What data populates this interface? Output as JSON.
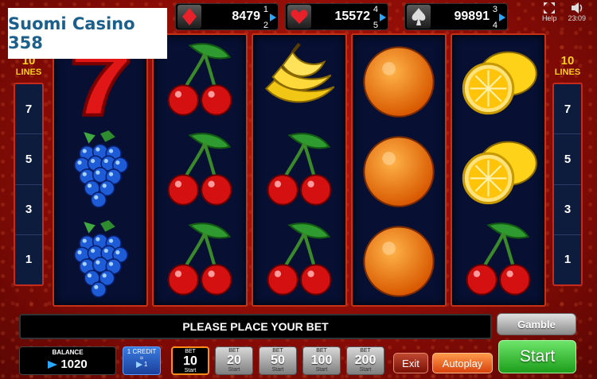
{
  "brand": {
    "logo_text": "Suomi Casino 358"
  },
  "jackpots": [
    {
      "suit": "diamond",
      "value": "8479",
      "level_top": "1",
      "level_bottom": "2",
      "suit_color": "#e8202a"
    },
    {
      "suit": "heart",
      "value": "15572",
      "level_top": "4",
      "level_bottom": "5",
      "suit_color": "#e8202a"
    },
    {
      "suit": "spade",
      "value": "99891",
      "level_top": "3",
      "level_bottom": "4",
      "suit_color": "#dddddd"
    }
  ],
  "tools": {
    "help_label": "Help",
    "clock": "23:09"
  },
  "lines": {
    "left_label_num": "10",
    "left_label_text": "LINES",
    "right_label_num": "10",
    "right_label_text": "LINES",
    "values": [
      "7",
      "5",
      "3",
      "1"
    ]
  },
  "reels": [
    [
      "seven",
      "grapes",
      "grapes"
    ],
    [
      "cherry",
      "cherry",
      "cherry"
    ],
    [
      "banana",
      "cherry",
      "cherry"
    ],
    [
      "orange",
      "orange",
      "orange"
    ],
    [
      "lemon",
      "lemon",
      "cherry"
    ]
  ],
  "message": "PLEASE PLACE YOUR BET",
  "gamble_label": "Gamble",
  "balance": {
    "label": "BALANCE",
    "value": "1020"
  },
  "credit": {
    "line1": "1 CREDIT",
    "line2": "=",
    "line3": "1"
  },
  "bets": [
    {
      "label": "BET",
      "value": "10",
      "sub": "Start",
      "active": true
    },
    {
      "label": "BET",
      "value": "20",
      "sub": "Start",
      "active": false
    },
    {
      "label": "BET",
      "value": "50",
      "sub": "Start",
      "active": false
    },
    {
      "label": "BET",
      "value": "100",
      "sub": "Start",
      "active": false
    },
    {
      "label": "BET",
      "value": "200",
      "sub": "Start",
      "active": false
    }
  ],
  "buttons": {
    "exit": "Exit",
    "autoplay": "Autoplay",
    "start": "Start"
  },
  "colors": {
    "accent_red": "#c83214",
    "start_green": "#1d9d1a",
    "autoplay_orange": "#d8420e"
  }
}
